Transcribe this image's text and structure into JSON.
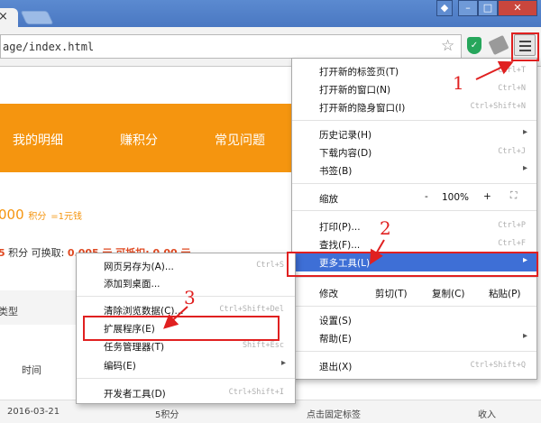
{
  "browser": {
    "tab_close": "×",
    "window_buttons": {
      "user": "◆",
      "minimize": "–",
      "maximize": "□",
      "close": "✕"
    },
    "url": "age/index.html",
    "star_icon": "☆",
    "shield_icon": "✓"
  },
  "page": {
    "nav": [
      "我的明细",
      "赚积分",
      "常见问题"
    ],
    "points_value": "000",
    "points_unit": "积分",
    "points_rate": "=1元钱",
    "row2_value": "5",
    "row2_text": "积分  可换取:",
    "row2_tail": "0.005  元 可抵扣: 0.00 元",
    "type_label": "类型",
    "time_header": "时间",
    "footer": {
      "date": "2016-03-21",
      "points": "5积分",
      "action": "点击固定标签",
      "type": "收入"
    }
  },
  "main_menu": {
    "items": [
      {
        "label": "打开新的标签页(T)",
        "shortcut": "Ctrl+T"
      },
      {
        "label": "打开新的窗口(N)",
        "shortcut": "Ctrl+N"
      },
      {
        "label": "打开新的隐身窗口(I)",
        "shortcut": "Ctrl+Shift+N"
      },
      {
        "label": "历史记录(H)",
        "arrow": "▸"
      },
      {
        "label": "下载内容(D)",
        "shortcut": "Ctrl+J"
      },
      {
        "label": "书签(B)",
        "arrow": "▸"
      },
      {
        "label": "打印(P)...",
        "shortcut": "Ctrl+P"
      },
      {
        "label": "查找(F)...",
        "shortcut": "Ctrl+F"
      },
      {
        "label": "更多工具(L)",
        "arrow": "▸"
      },
      {
        "label": "设置(S)"
      },
      {
        "label": "帮助(E)",
        "arrow": "▸"
      },
      {
        "label": "退出(X)",
        "shortcut": "Ctrl+Shift+Q"
      }
    ],
    "zoom": {
      "label": "缩放",
      "minus": "-",
      "value": "100%",
      "plus": "+",
      "fullscreen": "⛶"
    },
    "edit": {
      "label": "修改",
      "cut": "剪切(T)",
      "copy": "复制(C)",
      "paste": "粘贴(P)"
    }
  },
  "submenu": {
    "items": [
      {
        "label": "网页另存为(A)...",
        "shortcut": "Ctrl+S"
      },
      {
        "label": "添加到桌面..."
      },
      {
        "label": "清除浏览数据(C)...",
        "shortcut": "Ctrl+Shift+Del"
      },
      {
        "label": "扩展程序(E)"
      },
      {
        "label": "任务管理器(T)",
        "shortcut": "Shift+Esc"
      },
      {
        "label": "编码(E)",
        "arrow": "▸"
      },
      {
        "label": "开发者工具(D)",
        "shortcut": "Ctrl+Shift+I"
      }
    ]
  },
  "annotations": [
    "1",
    "2",
    "3"
  ],
  "colors": {
    "accent": "#f5950f",
    "highlight": "#3e6fd6",
    "annotation": "#e02020"
  }
}
